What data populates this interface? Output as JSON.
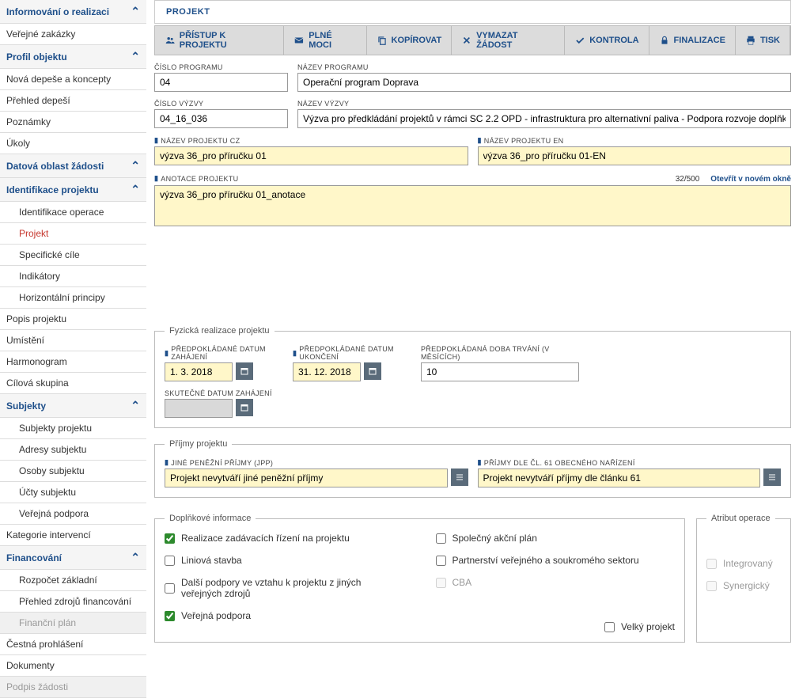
{
  "sidebar": {
    "s1": "Informování o realizaci",
    "s1_1": "Veřejné zakázky",
    "s2": "Profil objektu",
    "s2_1": "Nová depeše a koncepty",
    "s2_2": "Přehled depeší",
    "s2_3": "Poznámky",
    "s2_4": "Úkoly",
    "s3": "Datová oblast žádosti",
    "s4": "Identifikace projektu",
    "s4_1": "Identifikace operace",
    "s4_2": "Projekt",
    "s4_3": "Specifické cíle",
    "s4_4": "Indikátory",
    "s4_5": "Horizontální principy",
    "s5": "Popis projektu",
    "s6": "Umístění",
    "s7": "Harmonogram",
    "s8": "Cílová skupina",
    "s9": "Subjekty",
    "s9_1": "Subjekty projektu",
    "s9_2": "Adresy subjektu",
    "s9_3": "Osoby subjektu",
    "s9_4": "Účty subjektu",
    "s9_5": "Veřejná podpora",
    "s10": "Kategorie intervencí",
    "s11": "Financování",
    "s11_1": "Rozpočet základní",
    "s11_2": "Přehled zdrojů financování",
    "s11_3": "Finanční plán",
    "s12": "Čestná prohlášení",
    "s13": "Dokumenty",
    "s14": "Podpis žádosti"
  },
  "tab": "PROJEKT",
  "toolbar": {
    "access": "PŘÍSTUP K PROJEKTU",
    "power": "PLNÉ MOCI",
    "copy": "KOPÍROVAT",
    "delete": "VYMAZAT ŽÁDOST",
    "check": "KONTROLA",
    "finalize": "FINALIZACE",
    "print": "TISK"
  },
  "labels": {
    "prog_num": "ČÍSLO PROGRAMU",
    "prog_name": "NÁZEV PROGRAMU",
    "call_num": "ČÍSLO VÝZVY",
    "call_name": "NÁZEV VÝZVY",
    "proj_cz": "NÁZEV PROJEKTU CZ",
    "proj_en": "NÁZEV PROJEKTU EN",
    "annot": "ANOTACE PROJEKTU",
    "counter": "32/500",
    "newwin": "Otevřít v novém okně",
    "fyz": "Fyzická realizace projektu",
    "start": "PŘEDPOKLÁDANÉ DATUM ZAHÁJENÍ",
    "end": "PŘEDPOKLÁDANÉ DATUM UKONČENÍ",
    "dur": "PŘEDPOKLÁDANÁ DOBA TRVÁNÍ (V MĚSÍCÍCH)",
    "real_start": "SKUTEČNÉ DATUM ZAHÁJENÍ",
    "income": "Příjmy projektu",
    "jpp": "JINÉ PENĚŽNÍ PŘÍJMY (JPP)",
    "art61": "PŘÍJMY DLE ČL. 61 OBECNÉHO NAŘÍZENÍ",
    "addl": "Doplňkové informace",
    "attr": "Atribut operace"
  },
  "values": {
    "prog_num": "04",
    "prog_name": "Operační program Doprava",
    "call_num": "04_16_036",
    "call_name": "Výzva pro předkládání projektů v rámci SC 2.2 OPD - infrastruktura pro alternativní paliva - Podpora rozvoje doplňkové sítě dobíjecích stanic",
    "proj_cz": "výzva 36_pro příručku 01",
    "proj_en": "výzva 36_pro příručku 01-EN",
    "annot": "výzva 36_pro příručku 01_anotace",
    "start": "1. 3. 2018",
    "end": "31. 12. 2018",
    "dur": "10",
    "jpp": "Projekt nevytváří jiné peněžní příjmy",
    "art61": "Projekt nevytváří příjmy dle článku 61"
  },
  "checks": {
    "c1": "Realizace zadávacích řízení na projektu",
    "c2": "Liniová stavba",
    "c3": "Další podpory ve vztahu k projektu z jiných veřejných zdrojů",
    "c4": "Veřejná podpora",
    "c5": "Společný akční plán",
    "c6": "Partnerství veřejného a soukromého sektoru",
    "c7": "CBA",
    "c8": "Velký projekt",
    "c9": "Integrovaný",
    "c10": "Synergický"
  }
}
